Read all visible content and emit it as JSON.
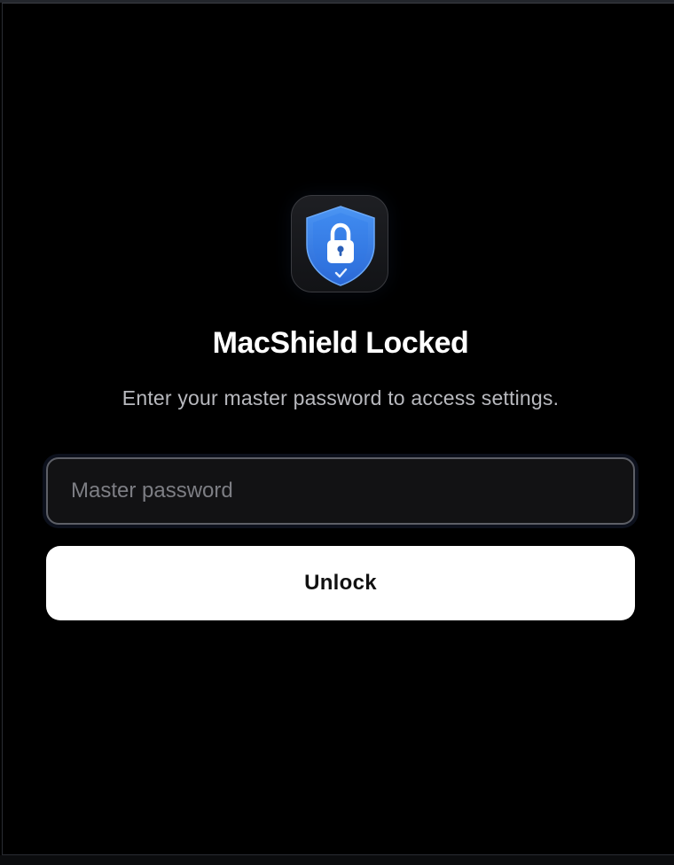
{
  "app": {
    "icon": "shield-lock-icon",
    "title": "MacShield Locked",
    "subtitle": "Enter your master password to access settings."
  },
  "form": {
    "password_value": "",
    "password_placeholder": "Master password",
    "unlock_label": "Unlock"
  },
  "colors": {
    "background": "#000000",
    "shield_blue": "#3d86ee",
    "button_bg": "#ffffff",
    "button_text": "#111111",
    "subtitle_text": "#b8b9be"
  }
}
